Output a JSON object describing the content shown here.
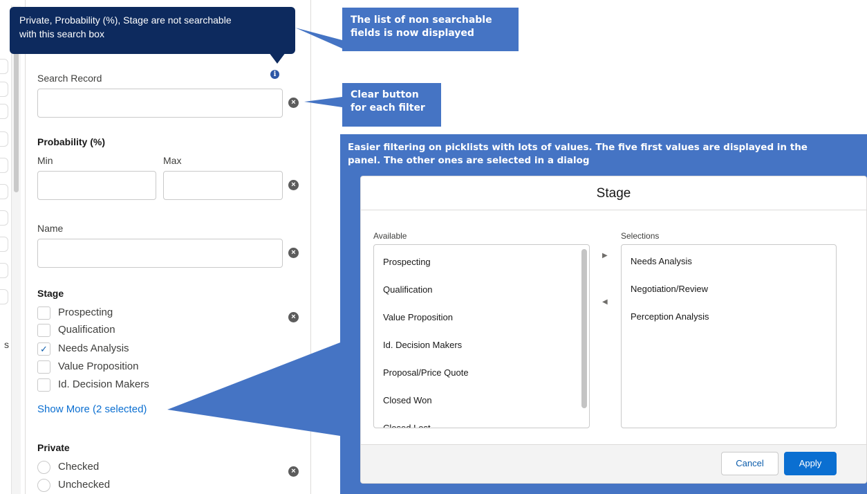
{
  "tooltip": {
    "line1": "Private, Probability (%), Stage are not searchable",
    "line2": "with this search box"
  },
  "callouts": {
    "non_searchable": {
      "line1": "The list of non searchable",
      "line2": "fields is now displayed"
    },
    "clear_button": {
      "line1": "Clear button",
      "line2": "for each filter"
    },
    "picklist": {
      "line1": "Easier filtering on picklists with lots of values. The five first values are displayed in the",
      "line2": "panel. The other ones are selected in a  dialog"
    }
  },
  "left": {
    "partial_text": "s"
  },
  "panel": {
    "search_label": "Search Record",
    "search_value": "",
    "probability": {
      "title": "Probability (%)",
      "min_label": "Min",
      "max_label": "Max",
      "min_value": "",
      "max_value": ""
    },
    "name": {
      "label": "Name",
      "value": ""
    },
    "stage": {
      "title": "Stage",
      "options": [
        {
          "label": "Prospecting",
          "checked": false
        },
        {
          "label": "Qualification",
          "checked": false
        },
        {
          "label": "Needs Analysis",
          "checked": true
        },
        {
          "label": "Value Proposition",
          "checked": false
        },
        {
          "label": "Id. Decision Makers",
          "checked": false
        }
      ],
      "show_more": "Show More (2 selected)"
    },
    "private": {
      "title": "Private",
      "options": [
        "Checked",
        "Unchecked"
      ]
    }
  },
  "dialog": {
    "title": "Stage",
    "available_label": "Available",
    "selections_label": "Selections",
    "available": [
      "Prospecting",
      "Qualification",
      "Value Proposition",
      "Id. Decision Makers",
      "Proposal/Price Quote",
      "Closed Won",
      "Closed Lost"
    ],
    "selections": [
      "Needs Analysis",
      "Negotiation/Review",
      "Perception Analysis"
    ],
    "cancel": "Cancel",
    "apply": "Apply"
  },
  "colors": {
    "callout": "#4574c4",
    "tooltip": "#0d2a5e",
    "link": "#0b6fd1",
    "apply": "#0b6fd1"
  },
  "icons": {
    "clear": "clear-icon",
    "info": "info-icon",
    "move_right": "arrow-right-icon",
    "move_left": "arrow-left-icon",
    "check": "checkmark-icon"
  }
}
